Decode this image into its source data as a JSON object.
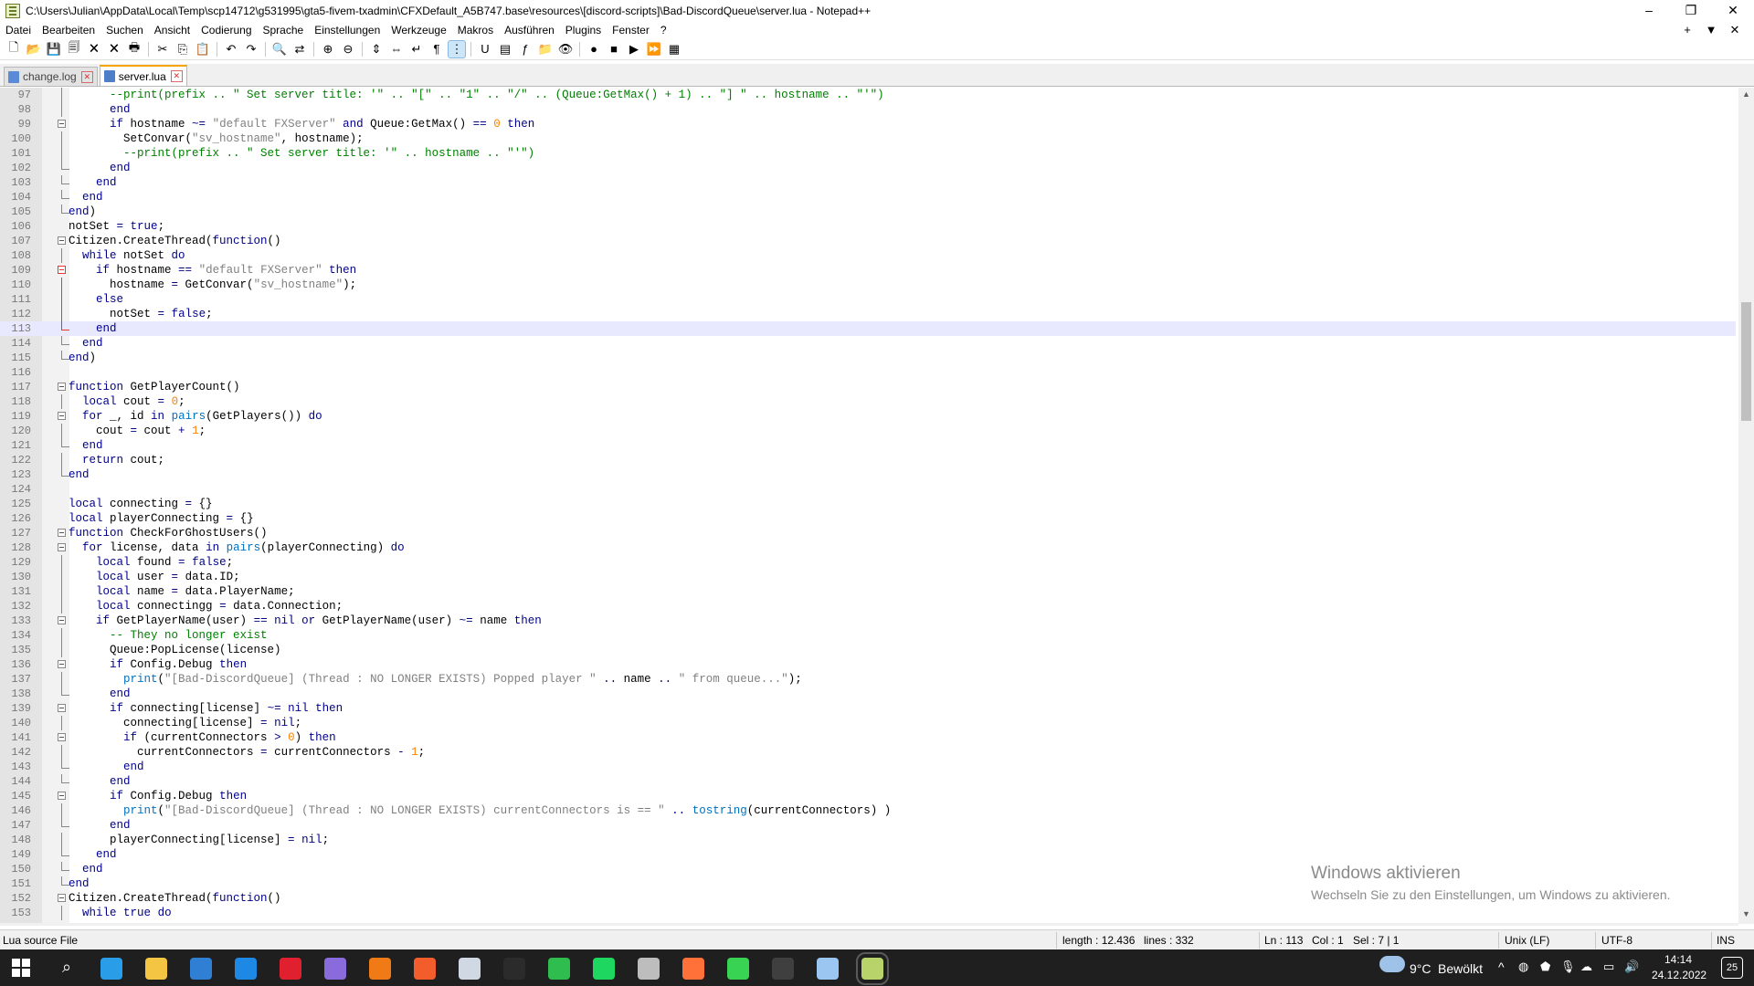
{
  "window": {
    "title": "C:\\Users\\Julian\\AppData\\Local\\Temp\\scp14712\\g531995\\gta5-fivem-txadmin\\CFXDefault_A5B747.base\\resources\\[discord-scripts]\\Bad-DiscordQueue\\server.lua - Notepad++",
    "min_glyph": "–",
    "max_glyph": "❐",
    "close_glyph": "✕"
  },
  "menu": {
    "items": [
      "Datei",
      "Bearbeiten",
      "Suchen",
      "Ansicht",
      "Codierung",
      "Sprache",
      "Einstellungen",
      "Werkzeuge",
      "Makros",
      "Ausführen",
      "Plugins",
      "Fenster",
      "?"
    ],
    "right": [
      "+",
      "▼",
      "✕"
    ]
  },
  "toolbar": {
    "icons": [
      "new-file-icon",
      "open-file-icon",
      "save-icon",
      "save-all-icon",
      "close-icon",
      "close-all-icon",
      "print-icon",
      "sep",
      "cut-icon",
      "copy-icon",
      "paste-icon",
      "sep",
      "undo-icon",
      "redo-icon",
      "sep",
      "find-icon",
      "replace-icon",
      "sep",
      "zoom-in-icon",
      "zoom-out-icon",
      "sep",
      "sync-vertical-icon",
      "sync-horizontal-icon",
      "word-wrap-icon",
      "show-all-chars-icon",
      "indent-guide-icon",
      "sep",
      "udl-icon",
      "doc-map-icon",
      "function-list-icon",
      "folder-workspace-icon",
      "monitoring-icon",
      "sep",
      "record-macro-icon",
      "stop-macro-icon",
      "play-macro-icon",
      "run-macro-multiple-icon",
      "save-macro-icon"
    ],
    "glyphs": {
      "new-file-icon": "🗋",
      "open-file-icon": "📂",
      "save-icon": "💾",
      "save-all-icon": "🗐",
      "close-icon": "🗙",
      "close-all-icon": "🗙",
      "print-icon": "🖶",
      "cut-icon": "✂",
      "copy-icon": "⎘",
      "paste-icon": "📋",
      "undo-icon": "↶",
      "redo-icon": "↷",
      "find-icon": "🔍",
      "replace-icon": "⇄",
      "zoom-in-icon": "⊕",
      "zoom-out-icon": "⊖",
      "sync-vertical-icon": "⇕",
      "sync-horizontal-icon": "⇔",
      "word-wrap-icon": "↵",
      "show-all-chars-icon": "¶",
      "indent-guide-icon": "⋮",
      "udl-icon": "U",
      "doc-map-icon": "▤",
      "function-list-icon": "ƒ",
      "folder-workspace-icon": "📁",
      "monitoring-icon": "👁",
      "record-macro-icon": "●",
      "stop-macro-icon": "■",
      "play-macro-icon": "▶",
      "run-macro-multiple-icon": "⏩",
      "save-macro-icon": "▦"
    },
    "active": [
      "indent-guide-icon"
    ]
  },
  "tabs": [
    {
      "label": "change.log",
      "active": false
    },
    {
      "label": "server.lua",
      "active": true
    }
  ],
  "editor": {
    "current_line": 113,
    "lines": [
      {
        "n": "97",
        "fold": "v",
        "code": "      <span class='c'>--print(prefix .. \" Set server title: '\" .. \"[\" .. \"1\" .. \"/\" .. (Queue:GetMax() + 1) .. \"] \" .. hostname .. \"'\")</span>"
      },
      {
        "n": "98",
        "fold": "v",
        "code": "      <span class='k'>end</span>"
      },
      {
        "n": "99",
        "fold": "box",
        "code": "      <span class='k'>if</span> hostname <span class='op'>~=</span> <span class='s'>\"default FXServer\"</span> <span class='k'>and</span> Queue:GetMax() <span class='op'>==</span> <span class='n'>0</span> <span class='k'>then</span>"
      },
      {
        "n": "100",
        "fold": "v",
        "code": "        SetConvar(<span class='s'>\"sv_hostname\"</span>, hostname);"
      },
      {
        "n": "101",
        "fold": "v",
        "code": "        <span class='c'>--print(prefix .. \" Set server title: '\" .. hostname .. \"'\")</span>"
      },
      {
        "n": "102",
        "fold": "corner",
        "code": "      <span class='k'>end</span>"
      },
      {
        "n": "103",
        "fold": "corner",
        "code": "    <span class='k'>end</span>"
      },
      {
        "n": "104",
        "fold": "corner",
        "code": "  <span class='k'>end</span>"
      },
      {
        "n": "105",
        "fold": "corner",
        "code": "<span class='k'>end</span>)"
      },
      {
        "n": "106",
        "fold": "",
        "code": "notSet <span class='op'>=</span> <span class='k'>true</span>;"
      },
      {
        "n": "107",
        "fold": "box",
        "code": "Citizen.CreateThread(<span class='k'>function</span>()"
      },
      {
        "n": "108",
        "fold": "v",
        "code": "  <span class='k'>while</span> notSet <span class='k'>do</span>"
      },
      {
        "n": "109",
        "fold": "boxred",
        "code": "    <span class='k'>if</span> hostname <span class='op'>==</span> <span class='s'>\"default FXServer\"</span> <span class='k'>then</span>"
      },
      {
        "n": "110",
        "fold": "vred",
        "code": "      hostname <span class='op'>=</span> GetConvar(<span class='s'>\"sv_hostname\"</span>);"
      },
      {
        "n": "111",
        "fold": "vred",
        "code": "    <span class='k'>else</span>"
      },
      {
        "n": "112",
        "fold": "vred",
        "code": "      notSet <span class='op'>=</span> <span class='k'>false</span>;"
      },
      {
        "n": "113",
        "fold": "cornerred",
        "code": "    <span class='k'>end</span>"
      },
      {
        "n": "114",
        "fold": "corner",
        "code": "  <span class='k'>end</span>"
      },
      {
        "n": "115",
        "fold": "corner",
        "code": "<span class='k'>end</span>)"
      },
      {
        "n": "116",
        "fold": "",
        "code": ""
      },
      {
        "n": "117",
        "fold": "box",
        "code": "<span class='k'>function</span> GetPlayerCount()"
      },
      {
        "n": "118",
        "fold": "v",
        "code": "  <span class='k'>local</span> cout <span class='op'>=</span> <span class='n'>0</span>;"
      },
      {
        "n": "119",
        "fold": "box",
        "code": "  <span class='k'>for</span> _, id <span class='k'>in</span> <span class='f'>pairs</span>(GetPlayers()) <span class='k'>do</span>"
      },
      {
        "n": "120",
        "fold": "v",
        "code": "    cout <span class='op'>=</span> cout <span class='op'>+</span> <span class='n'>1</span>;"
      },
      {
        "n": "121",
        "fold": "corner",
        "code": "  <span class='k'>end</span>"
      },
      {
        "n": "122",
        "fold": "v",
        "code": "  <span class='k'>return</span> cout;"
      },
      {
        "n": "123",
        "fold": "corner",
        "code": "<span class='k'>end</span>"
      },
      {
        "n": "124",
        "fold": "",
        "code": ""
      },
      {
        "n": "125",
        "fold": "",
        "code": "<span class='k'>local</span> connecting <span class='op'>=</span> {}"
      },
      {
        "n": "126",
        "fold": "",
        "code": "<span class='k'>local</span> playerConnecting <span class='op'>=</span> {}"
      },
      {
        "n": "127",
        "fold": "box",
        "code": "<span class='k'>function</span> CheckForGhostUsers()"
      },
      {
        "n": "128",
        "fold": "box",
        "code": "  <span class='k'>for</span> license, data <span class='k'>in</span> <span class='f'>pairs</span>(playerConnecting) <span class='k'>do</span>"
      },
      {
        "n": "129",
        "fold": "v",
        "code": "    <span class='k'>local</span> found <span class='op'>=</span> <span class='k'>false</span>;"
      },
      {
        "n": "130",
        "fold": "v",
        "code": "    <span class='k'>local</span> user <span class='op'>=</span> data.ID;"
      },
      {
        "n": "131",
        "fold": "v",
        "code": "    <span class='k'>local</span> name <span class='op'>=</span> data.PlayerName;"
      },
      {
        "n": "132",
        "fold": "v",
        "code": "    <span class='k'>local</span> connectingg <span class='op'>=</span> data.Connection;"
      },
      {
        "n": "133",
        "fold": "box",
        "code": "    <span class='k'>if</span> GetPlayerName(user) <span class='op'>==</span> <span class='k'>nil</span> <span class='k'>or</span> GetPlayerName(user) <span class='op'>~=</span> name <span class='k'>then</span>"
      },
      {
        "n": "134",
        "fold": "v",
        "code": "      <span class='c'>-- They no longer exist</span>"
      },
      {
        "n": "135",
        "fold": "v",
        "code": "      Queue:PopLicense(license)"
      },
      {
        "n": "136",
        "fold": "box",
        "code": "      <span class='k'>if</span> Config.Debug <span class='k'>then</span>"
      },
      {
        "n": "137",
        "fold": "v",
        "code": "        <span class='f'>print</span>(<span class='s'>\"[Bad-DiscordQueue] (Thread : NO LONGER EXISTS) Popped player \"</span> <span class='op'>..</span> name <span class='op'>..</span> <span class='s'>\" from queue...\"</span>);"
      },
      {
        "n": "138",
        "fold": "corner",
        "code": "      <span class='k'>end</span>"
      },
      {
        "n": "139",
        "fold": "box",
        "code": "      <span class='k'>if</span> connecting[license] <span class='op'>~=</span> <span class='k'>nil</span> <span class='k'>then</span>"
      },
      {
        "n": "140",
        "fold": "v",
        "code": "        connecting[license] <span class='op'>=</span> <span class='k'>nil</span>;"
      },
      {
        "n": "141",
        "fold": "box",
        "code": "        <span class='k'>if</span> (currentConnectors <span class='op'>&gt;</span> <span class='n'>0</span>) <span class='k'>then</span>"
      },
      {
        "n": "142",
        "fold": "v",
        "code": "          currentConnectors <span class='op'>=</span> currentConnectors <span class='op'>-</span> <span class='n'>1</span>;"
      },
      {
        "n": "143",
        "fold": "corner",
        "code": "        <span class='k'>end</span>"
      },
      {
        "n": "144",
        "fold": "corner",
        "code": "      <span class='k'>end</span>"
      },
      {
        "n": "145",
        "fold": "box",
        "code": "      <span class='k'>if</span> Config.Debug <span class='k'>then</span>"
      },
      {
        "n": "146",
        "fold": "v",
        "code": "        <span class='f'>print</span>(<span class='s'>\"[Bad-DiscordQueue] (Thread : NO LONGER EXISTS) currentConnectors is == \"</span> <span class='op'>..</span> <span class='f'>tostring</span>(currentConnectors) )"
      },
      {
        "n": "147",
        "fold": "corner",
        "code": "      <span class='k'>end</span>"
      },
      {
        "n": "148",
        "fold": "v",
        "code": "      playerConnecting[license] <span class='op'>=</span> <span class='k'>nil</span>;"
      },
      {
        "n": "149",
        "fold": "corner",
        "code": "    <span class='k'>end</span>"
      },
      {
        "n": "150",
        "fold": "corner",
        "code": "  <span class='k'>end</span>"
      },
      {
        "n": "151",
        "fold": "corner",
        "code": "<span class='k'>end</span>"
      },
      {
        "n": "152",
        "fold": "box",
        "code": "Citizen.CreateThread(<span class='k'>function</span>()"
      },
      {
        "n": "153",
        "fold": "v",
        "code": "  <span class='k'>while</span> <span class='k'>true</span> <span class='k'>do</span>"
      }
    ]
  },
  "watermark": {
    "title": "Windows aktivieren",
    "subtitle": "Wechseln Sie zu den Einstellungen, um Windows zu aktivieren."
  },
  "status": {
    "file_type": "Lua source File",
    "length": "length : 12.436",
    "lines": "lines : 332",
    "ln": "Ln : 113",
    "col": "Col : 1",
    "sel": "Sel : 7 | 1",
    "eol": "Unix (LF)",
    "encoding": "UTF-8",
    "mode": "INS"
  },
  "taskbar": {
    "weather_temp": "9°C",
    "weather_text": "Bewölkt",
    "time": "14:14",
    "date": "24.12.2022",
    "notification_count": "25",
    "apps": [
      {
        "name": "start-icon",
        "color": "#ffffff"
      },
      {
        "name": "search-icon",
        "color": "#ffffff"
      },
      {
        "name": "edge-icon",
        "color": "#2a9de8"
      },
      {
        "name": "explorer-icon",
        "color": "#f4c542"
      },
      {
        "name": "store-icon",
        "color": "#2f7fd4"
      },
      {
        "name": "mail-icon",
        "color": "#1e88e5"
      },
      {
        "name": "opera-icon",
        "color": "#e0202e"
      },
      {
        "name": "discord-icon",
        "color": "#8a6bdb"
      },
      {
        "name": "app-icon",
        "color": "#f07b16"
      },
      {
        "name": "map-pin-icon",
        "color": "#f25d2b"
      },
      {
        "name": "steam-icon",
        "color": "#cfd8e3"
      },
      {
        "name": "epic-games-icon",
        "color": "#2b2b2b"
      },
      {
        "name": "xbox-icon",
        "color": "#2ebd4e"
      },
      {
        "name": "spotify-icon",
        "color": "#1ed760"
      },
      {
        "name": "network-icon",
        "color": "#bdbdbd"
      },
      {
        "name": "firefox-icon",
        "color": "#ff7139"
      },
      {
        "name": "app-green-icon",
        "color": "#39d353"
      },
      {
        "name": "excel-like-icon",
        "color": "#3f3f3f"
      },
      {
        "name": "steam-2-icon",
        "color": "#9ac6f1"
      },
      {
        "name": "notepadpp-icon",
        "color": "#b7d36a"
      }
    ]
  }
}
